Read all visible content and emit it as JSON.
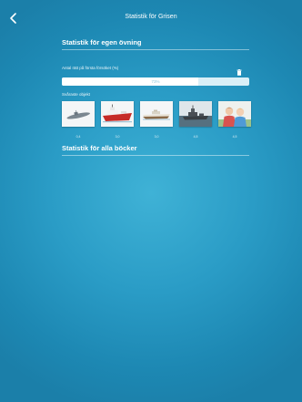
{
  "header": {
    "title": "Statistik för Grisen"
  },
  "own_exercise": {
    "title": "Statistik för egen övning",
    "first_try_label": "Antal rätt på första försöket (%)",
    "progress_text": "73%",
    "progress_fraction": 0.73,
    "hardest_label": "Svåraste objekt",
    "hardest_objects": [
      {
        "icon": "submarine-icon",
        "value": "0,4"
      },
      {
        "icon": "ship-icon",
        "value": "3,0"
      },
      {
        "icon": "boat-icon",
        "value": "3,0"
      },
      {
        "icon": "warship-icon",
        "value": "4,5"
      },
      {
        "icon": "children-icon",
        "value": "4,5"
      }
    ]
  },
  "all_books": {
    "title": "Statistik för alla böcker"
  },
  "colors": {
    "background": "#2a9cc6",
    "progress_track": "#d9eff7",
    "progress_fill": "#ffffff",
    "text": "#ffffff"
  }
}
